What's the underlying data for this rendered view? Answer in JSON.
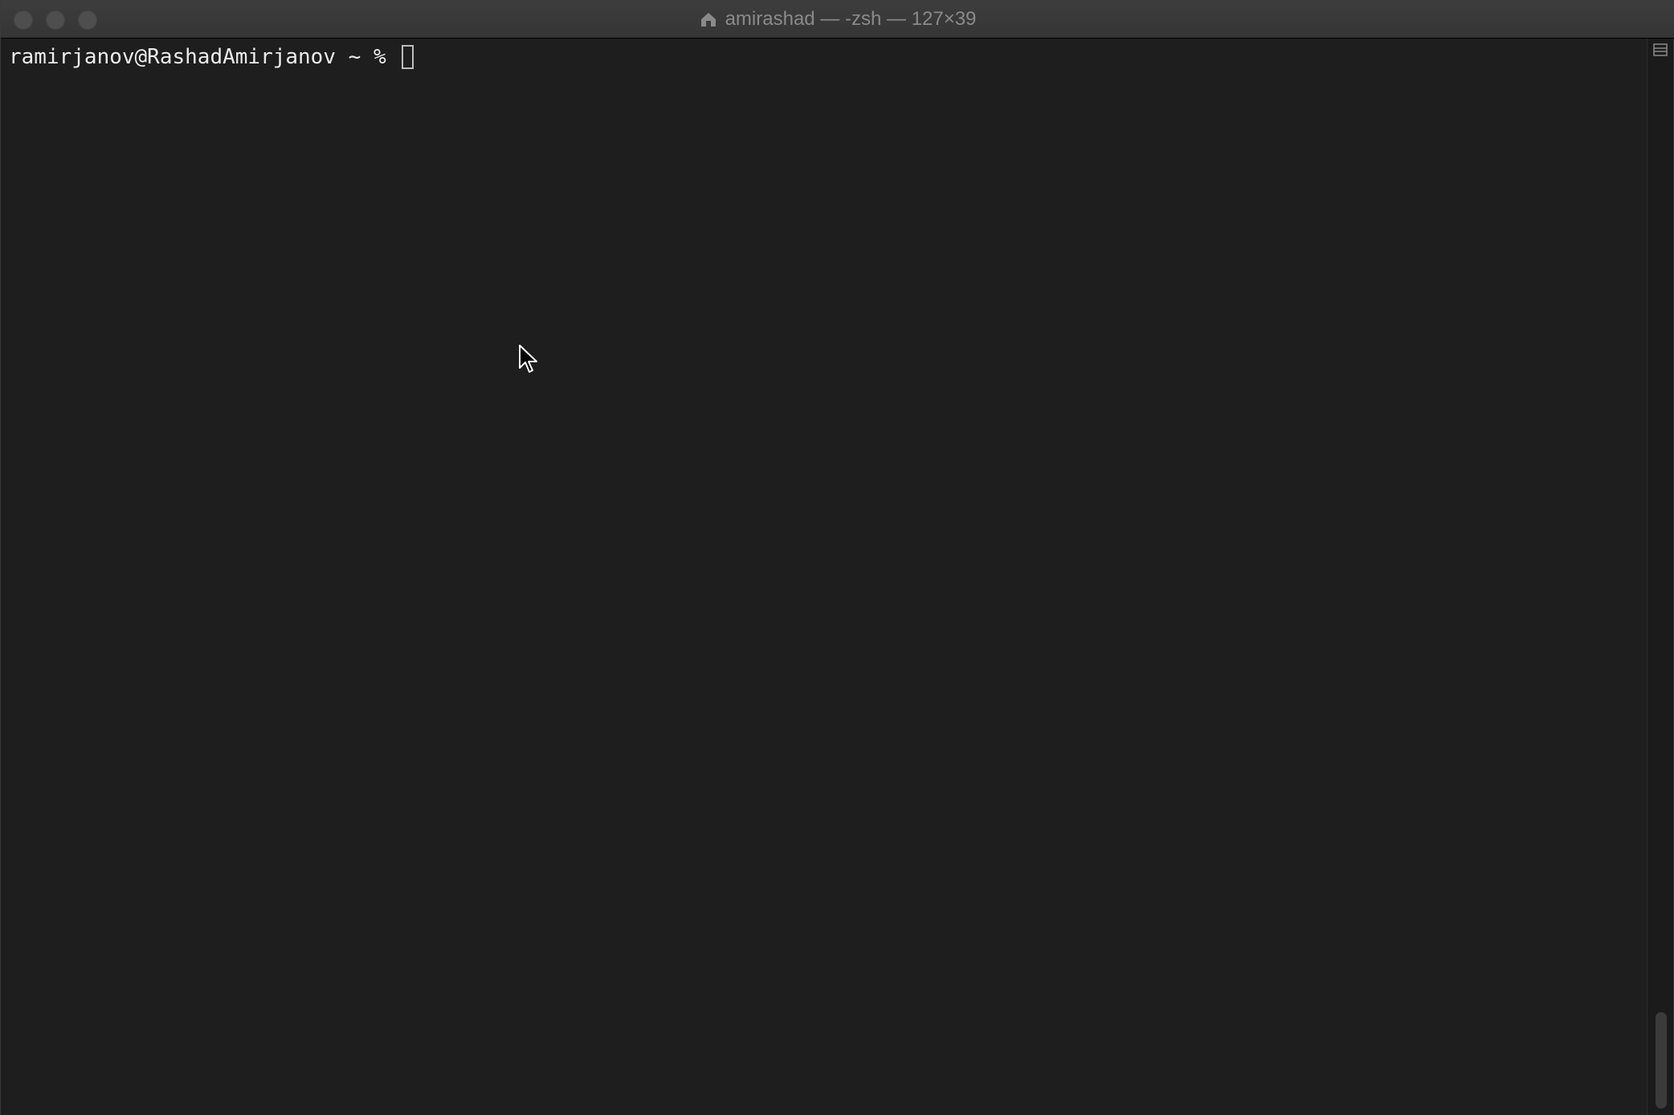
{
  "window": {
    "title": "amirashad — -zsh — 127×39",
    "title_icon": "home-folder-icon"
  },
  "traffic_lights": {
    "close": "close-button",
    "minimize": "minimize-button",
    "zoom": "zoom-button"
  },
  "terminal": {
    "prompt": "ramirjanov@RashadAmirjanov ~ % ",
    "input_value": ""
  },
  "scrollbar": {
    "split_icon": "split-pane-icon"
  },
  "colors": {
    "background": "#1e1e1e",
    "text": "#ececec",
    "titlebar": "#3a3a3a",
    "title_text": "#8a8a8a"
  }
}
